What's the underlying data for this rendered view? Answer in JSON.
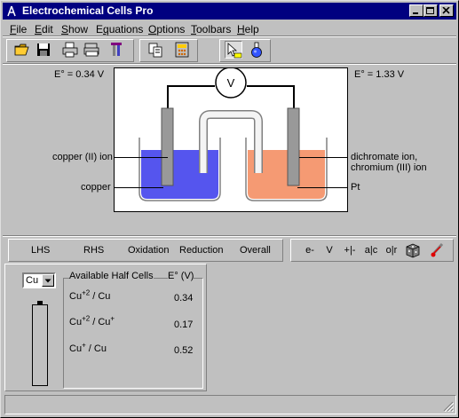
{
  "window": {
    "title": "Electrochemical Cells Pro"
  },
  "menu": [
    {
      "label": "File",
      "key": "F",
      "rest": "ile"
    },
    {
      "label": "Edit",
      "key": "E",
      "rest": "dit"
    },
    {
      "label": "Show",
      "key": "S",
      "rest": "how"
    },
    {
      "label": "Equations",
      "key": "q",
      "pre": "E",
      "rest": "uations"
    },
    {
      "label": "Options",
      "key": "O",
      "rest": "ptions"
    },
    {
      "label": "Toolbars",
      "key": "T",
      "rest": "oolbars"
    },
    {
      "label": "Help",
      "key": "H",
      "rest": "elp"
    }
  ],
  "toolbar": {
    "icons": [
      "open-folder-icon",
      "save-icon",
      "print-icon",
      "print-multiple-icon",
      "tool-icon",
      "copy-icon",
      "calculator-icon",
      "pointer-icon",
      "flask-icon"
    ]
  },
  "cell": {
    "left_potential": "E° = 0.34 V",
    "right_potential": "E° = 1.33 V",
    "voltmeter": "V",
    "left_solution": "copper (II) ion",
    "left_electrode": "copper",
    "right_solution_1": "dichromate ion,",
    "right_solution_2": "chromium (III) ion",
    "right_electrode": "Pt",
    "left_color": "#5555ee",
    "right_color": "#f59a73"
  },
  "tabs": {
    "items": [
      "LHS",
      "RHS",
      "Oxidation",
      "Reduction",
      "Overall"
    ],
    "buttons": [
      "e-",
      "V",
      "+|-",
      "a|c",
      "o|r"
    ]
  },
  "halfcells": {
    "selected": "Cu",
    "header_label": "Available Half Cells",
    "header_value": "E° (V)",
    "rows": [
      {
        "species": "Cu",
        "charge": "+2",
        "product": "Cu",
        "product_charge": "",
        "value": "0.34"
      },
      {
        "species": "Cu",
        "charge": "+2",
        "product": "Cu",
        "product_charge": "+",
        "value": "0.17"
      },
      {
        "species": "Cu",
        "charge": "+",
        "product": "Cu",
        "product_charge": "",
        "value": "0.52"
      }
    ]
  }
}
